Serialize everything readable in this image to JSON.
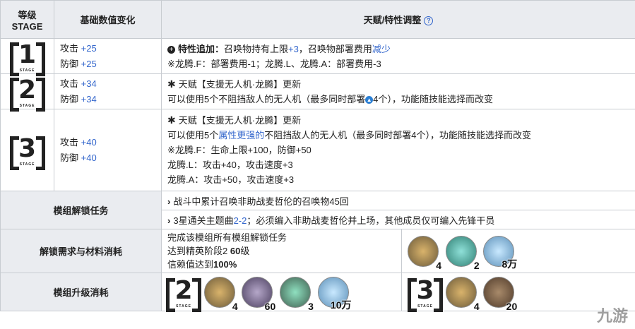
{
  "header": {
    "stage_col_line1": "等级",
    "stage_col_line2": "STAGE",
    "stats_col": "基础数值变化",
    "talent_col": "天赋/特性调整",
    "help_icon": "?"
  },
  "stages": [
    {
      "num": "1",
      "stage_label": "STAGE",
      "stats": [
        {
          "name": "攻击",
          "value": "+25"
        },
        {
          "name": "防御",
          "value": "+25"
        }
      ],
      "lines": {
        "l1_prefix": "特性追加：",
        "l1_text_a": "召唤物持有上限",
        "l1_value": "+3",
        "l1_text_b": "，召唤物部署费用",
        "l1_link": "减少",
        "l2": "※龙腾.F：部署费用-1；龙腾.L、龙腾.A：部署费用-3"
      }
    },
    {
      "num": "2",
      "stage_label": "STAGE",
      "stats": [
        {
          "name": "攻击",
          "value": "+34"
        },
        {
          "name": "防御",
          "value": "+34"
        }
      ],
      "lines": {
        "l1": "天赋【支援无人机·龙腾】更新",
        "l2_a": "可以使用5个不阻挡敌人的无人机（最多同时部署",
        "l2_b": "4个），功能随技能选择而改变"
      }
    },
    {
      "num": "3",
      "stage_label": "STAGE",
      "stats": [
        {
          "name": "攻击",
          "value": "+40"
        },
        {
          "name": "防御",
          "value": "+40"
        }
      ],
      "lines": {
        "l1": "天赋【支援无人机·龙腾】更新",
        "l2_a": "可以使用5个",
        "l2_link": "属性更强的",
        "l2_b": "不阻挡敌人的无人机（最多同时部署4个），功能随技能选择而改变",
        "l3": "※龙腾.F：生命上限+100，防御+50",
        "l4": "龙腾.L：攻击+40，攻击速度+3",
        "l5": "龙腾.A：攻击+50，攻击速度+3"
      }
    }
  ],
  "tasks": {
    "label": "模组解锁任务",
    "t1": "战斗中累计召唤非助战麦哲伦的召唤物45回",
    "t2_a": "3星通关主题曲",
    "t2_link": "2-2",
    "t2_b": "；必须编入非助战麦哲伦并上场，其他成员仅可编入先锋干员"
  },
  "unlock": {
    "label": "解锁需求与材料消耗",
    "r1": "完成该模组所有模组解锁任务",
    "r2_a": "达到精英阶段2 ",
    "r2_b": "60",
    "r2_c": "级",
    "r3_a": "信赖值达到",
    "r3_b": "100%",
    "mats": [
      "4",
      "2",
      "8万"
    ]
  },
  "upgrade": {
    "label": "模组升级消耗",
    "s2": {
      "num": "2",
      "stage_label": "STAGE",
      "mats": [
        "4",
        "60",
        "3",
        "10万"
      ]
    },
    "s3": {
      "num": "3",
      "stage_label": "STAGE",
      "mats": [
        "4",
        "20"
      ]
    }
  },
  "watermark": "九游",
  "colors": {
    "link": "#3366cc",
    "header_bg": "#eaecf0",
    "border": "#c8ccd1"
  }
}
